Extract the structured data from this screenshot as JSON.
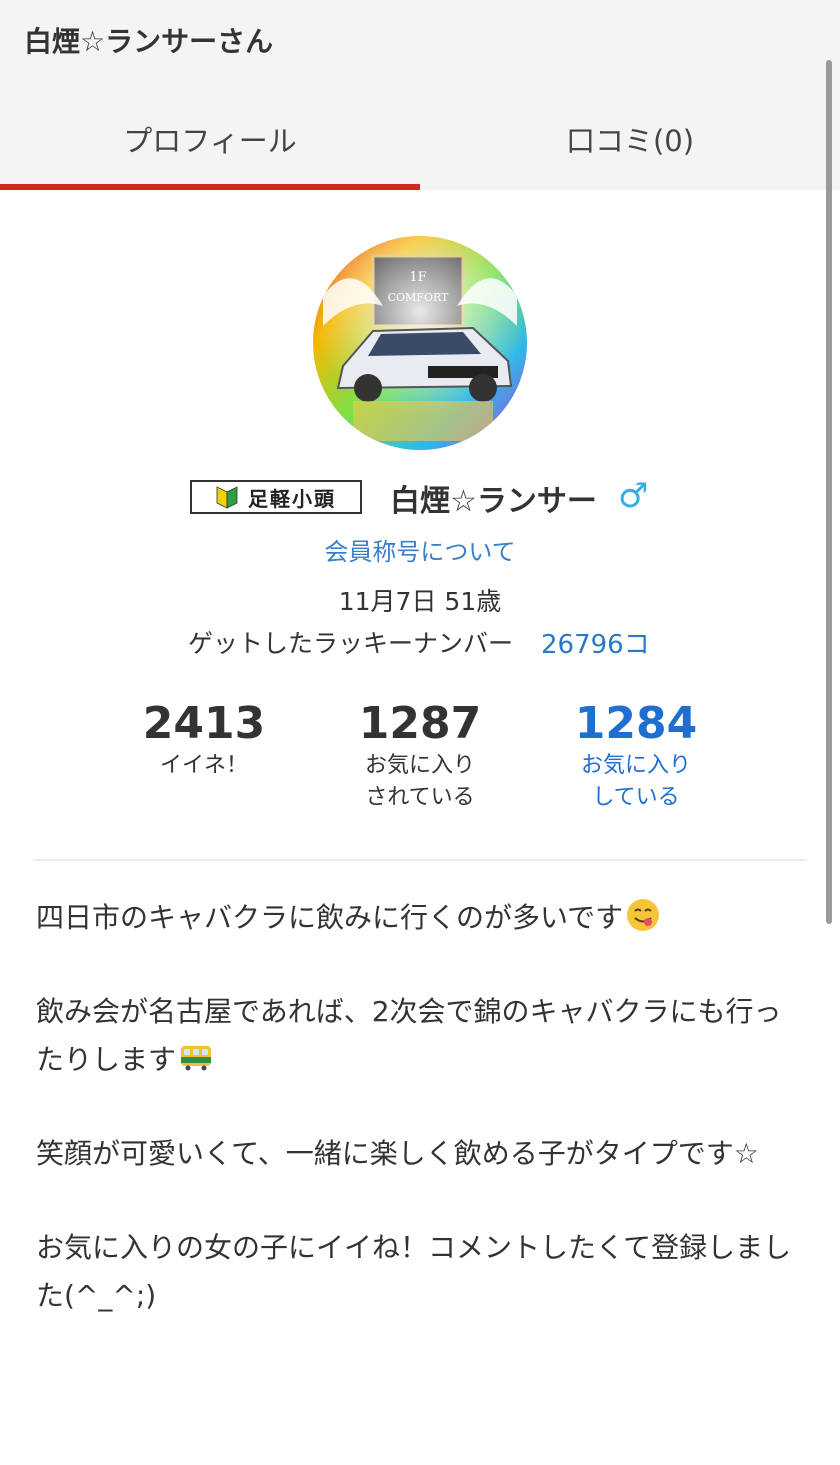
{
  "header": {
    "title": "白煙☆ランサーさん",
    "tabs": [
      {
        "label": "プロフィール",
        "active": true
      },
      {
        "label": "口コミ(0)",
        "active": false
      }
    ],
    "accent_color": "#d0281f"
  },
  "profile": {
    "avatar_icon": "avatar",
    "rank_badge": "足軽小頭",
    "username": "白煙☆ランサー",
    "gender_icon": "male-icon",
    "gender_symbol": "♂",
    "title_link": "会員称号について",
    "birth_age": "11月7日 51歳",
    "lucky_label": "ゲットしたラッキーナンバー",
    "lucky_value": "26796コ"
  },
  "stats": [
    {
      "value": "2413",
      "label_line1": "イイネ！",
      "label_line2": ""
    },
    {
      "value": "1287",
      "label_line1": "お気に入り",
      "label_line2": "されている"
    },
    {
      "value": "1284",
      "label_line1": "お気に入り",
      "label_line2": "している"
    }
  ],
  "bio": {
    "p1": "四日市のキャバクラに飲みに行くのが多いです",
    "p1_emoji": "savoring-face-emoji",
    "p2": "飲み会が名古屋であれば、2次会で錦のキャバクラにも行ったりします",
    "p2_emoji": "tram-emoji",
    "p3": "笑顔が可愛いくて、一緒に楽しく飲める子がタイプです☆",
    "p4": "お気に入りの女の子にイイね！コメントしたくて登録しました(^_^;)"
  }
}
